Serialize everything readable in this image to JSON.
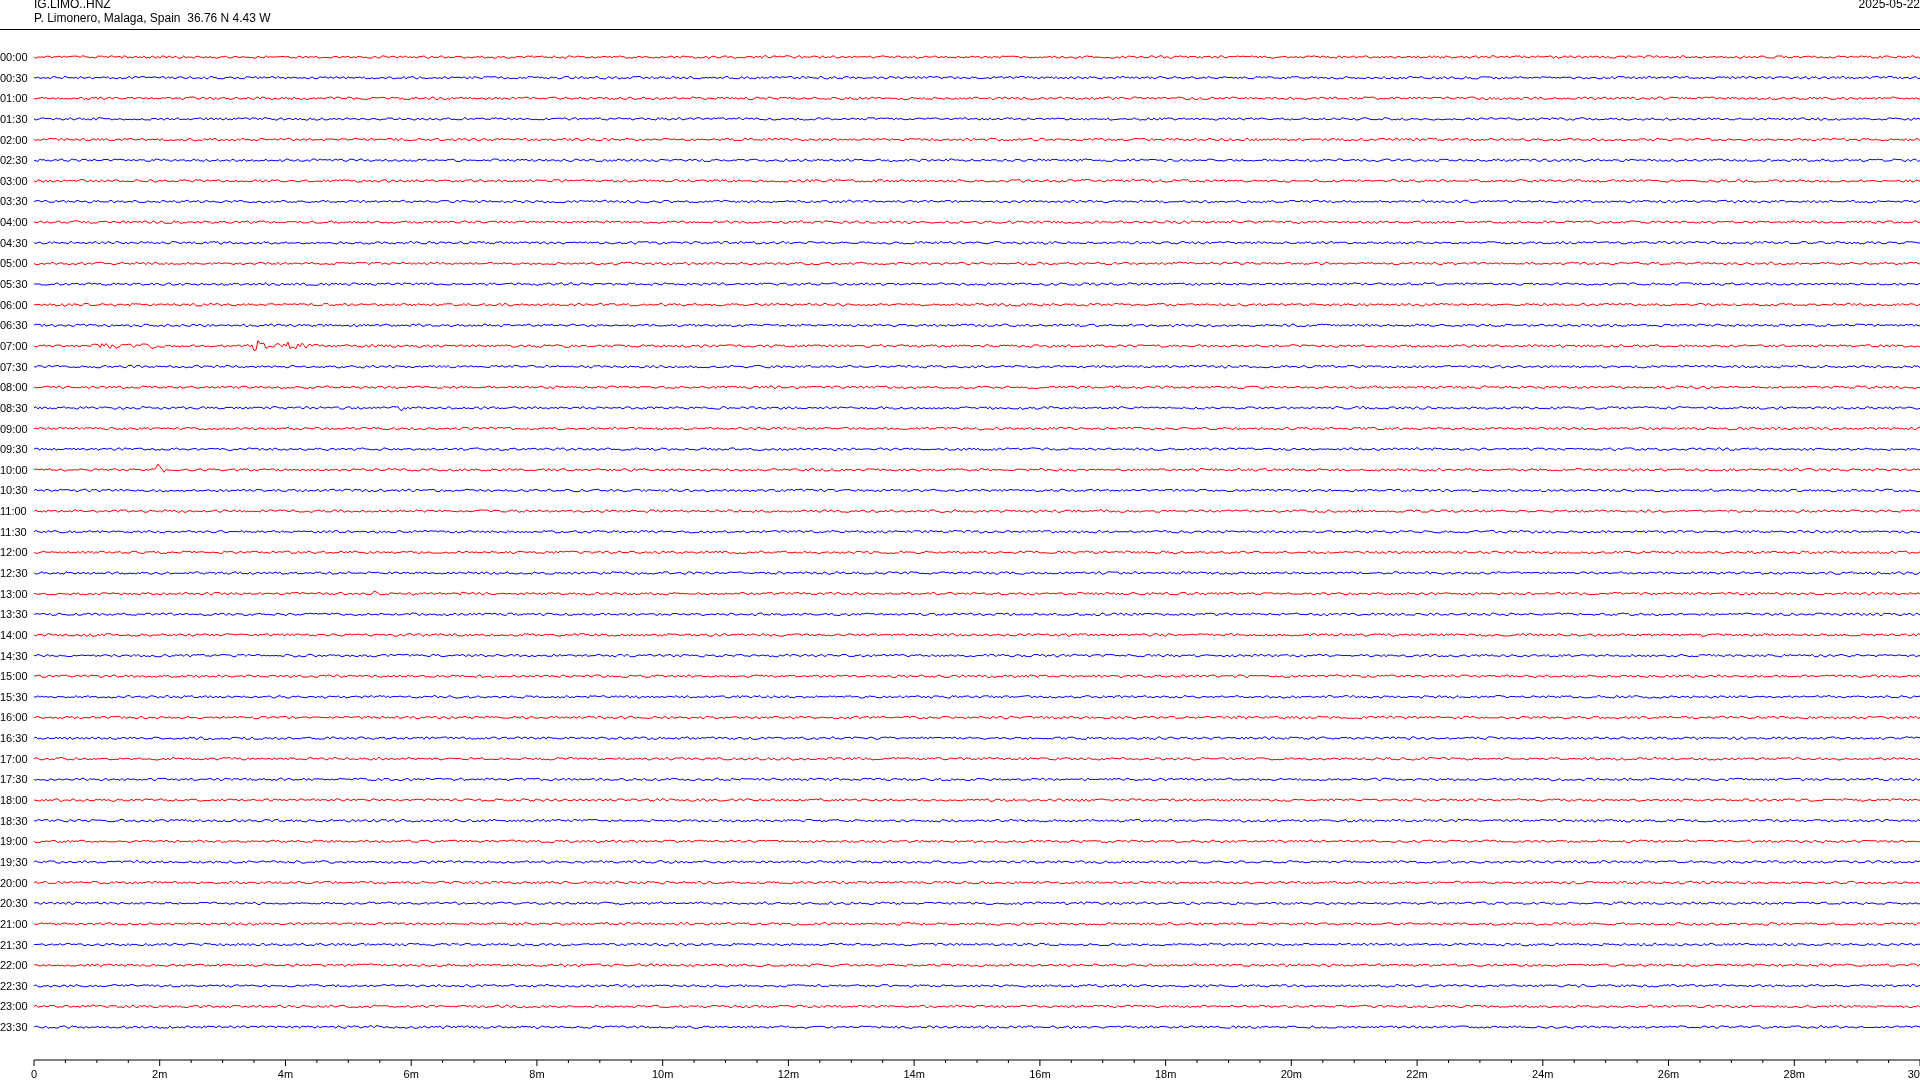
{
  "header": {
    "station": "IG.LIMO..HNZ",
    "location": "P. Limonero, Malaga, Spain  36.76 N 4.43 W",
    "date": "2025-05-22"
  },
  "rows": [
    {
      "time": "00:00",
      "color": "#ff0000"
    },
    {
      "time": "00:30",
      "color": "#0000ff"
    },
    {
      "time": "01:00",
      "color": "#ff0000"
    },
    {
      "time": "01:30",
      "color": "#0000ff"
    },
    {
      "time": "02:00",
      "color": "#ff0000"
    },
    {
      "time": "02:30",
      "color": "#0000ff"
    },
    {
      "time": "03:00",
      "color": "#ff0000"
    },
    {
      "time": "03:30",
      "color": "#0000ff"
    },
    {
      "time": "04:00",
      "color": "#ff0000"
    },
    {
      "time": "04:30",
      "color": "#0000ff"
    },
    {
      "time": "05:00",
      "color": "#ff0000"
    },
    {
      "time": "05:30",
      "color": "#0000ff"
    },
    {
      "time": "06:00",
      "color": "#ff0000"
    },
    {
      "time": "06:30",
      "color": "#0000ff"
    },
    {
      "time": "07:00",
      "color": "#ff0000"
    },
    {
      "time": "07:30",
      "color": "#0000ff"
    },
    {
      "time": "08:00",
      "color": "#ff0000"
    },
    {
      "time": "08:30",
      "color": "#0000ff"
    },
    {
      "time": "09:00",
      "color": "#ff0000"
    },
    {
      "time": "09:30",
      "color": "#0000ff"
    },
    {
      "time": "10:00",
      "color": "#ff0000"
    },
    {
      "time": "10:30",
      "color": "#0000ff"
    },
    {
      "time": "11:00",
      "color": "#ff0000"
    },
    {
      "time": "11:30",
      "color": "#0000ff"
    },
    {
      "time": "12:00",
      "color": "#ff0000"
    },
    {
      "time": "12:30",
      "color": "#0000ff"
    },
    {
      "time": "13:00",
      "color": "#ff0000"
    },
    {
      "time": "13:30",
      "color": "#0000ff"
    },
    {
      "time": "14:00",
      "color": "#ff0000"
    },
    {
      "time": "14:30",
      "color": "#0000ff"
    },
    {
      "time": "15:00",
      "color": "#ff0000"
    },
    {
      "time": "15:30",
      "color": "#0000ff"
    },
    {
      "time": "16:00",
      "color": "#ff0000"
    },
    {
      "time": "16:30",
      "color": "#0000ff"
    },
    {
      "time": "17:00",
      "color": "#ff0000"
    },
    {
      "time": "17:30",
      "color": "#0000ff"
    },
    {
      "time": "18:00",
      "color": "#ff0000"
    },
    {
      "time": "18:30",
      "color": "#0000ff"
    },
    {
      "time": "19:00",
      "color": "#ff0000"
    },
    {
      "time": "19:30",
      "color": "#0000ff"
    },
    {
      "time": "20:00",
      "color": "#ff0000"
    },
    {
      "time": "20:30",
      "color": "#0000ff"
    },
    {
      "time": "21:00",
      "color": "#ff0000"
    },
    {
      "time": "21:30",
      "color": "#0000ff"
    },
    {
      "time": "22:00",
      "color": "#ff0000"
    },
    {
      "time": "22:30",
      "color": "#0000ff"
    },
    {
      "time": "23:00",
      "color": "#ff0000"
    },
    {
      "time": "23:30",
      "color": "#0000ff"
    }
  ],
  "x_axis": {
    "labels": [
      "0",
      "2m",
      "4m",
      "6m",
      "8m",
      "10m",
      "12m",
      "14m",
      "16m",
      "18m",
      "20m",
      "22m",
      "24m",
      "26m",
      "28m",
      "30"
    ]
  }
}
